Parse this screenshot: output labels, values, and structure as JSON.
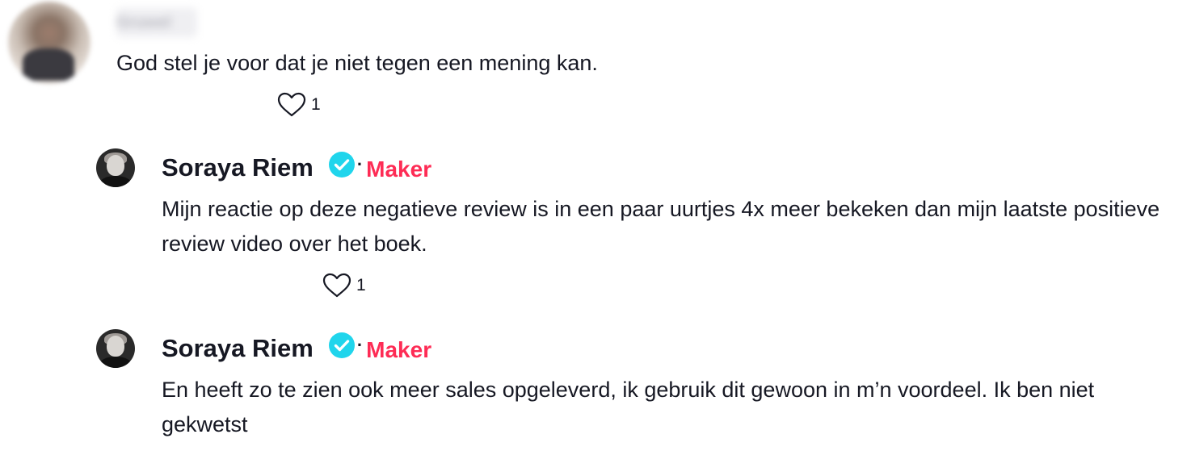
{
  "comment": {
    "username": "Gruwel",
    "text": "God stel je voor dat je niet tegen een mening kan.",
    "likes": "1"
  },
  "replies": [
    {
      "author": "Soraya Riem",
      "separator": "·",
      "badge": "Maker",
      "text": "Mijn reactie op deze negatieve review is in een paar uurtjes 4x meer bekeken dan mijn laatste positieve review video over het boek.",
      "likes": "1"
    },
    {
      "author": "Soraya Riem",
      "separator": "·",
      "badge": "Maker",
      "text": "En heeft zo te zien ook meer sales opgeleverd, ik gebruik dit gewoon in m’n voordeel. Ik ben niet gekwetst"
    }
  ],
  "colors": {
    "text": "#161823",
    "maker": "#fe2c55",
    "verified": "#20d5ec"
  },
  "icons": {
    "like": "heart-outline-icon",
    "verified": "verified-check-icon"
  }
}
